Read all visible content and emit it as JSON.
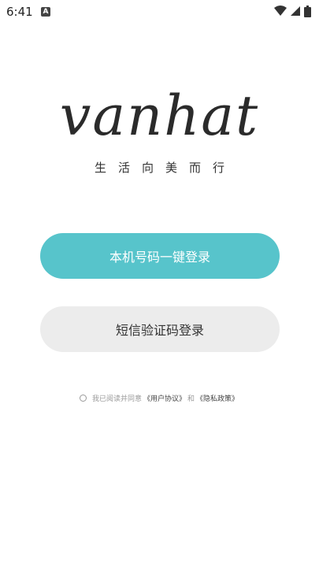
{
  "status_bar": {
    "time": "6:41",
    "notification_icon": "A"
  },
  "brand": {
    "logo": "vanhat",
    "tagline": "生活向美而行"
  },
  "actions": {
    "one_click_login": "本机号码一键登录",
    "sms_login": "短信验证码登录"
  },
  "agreement": {
    "prefix": "我已阅读并同意",
    "user_agreement": "《用户协议》",
    "and": "和",
    "privacy_policy": "《隐私政策》"
  },
  "colors": {
    "primary": "#57c4cb",
    "secondary": "#ececec"
  }
}
